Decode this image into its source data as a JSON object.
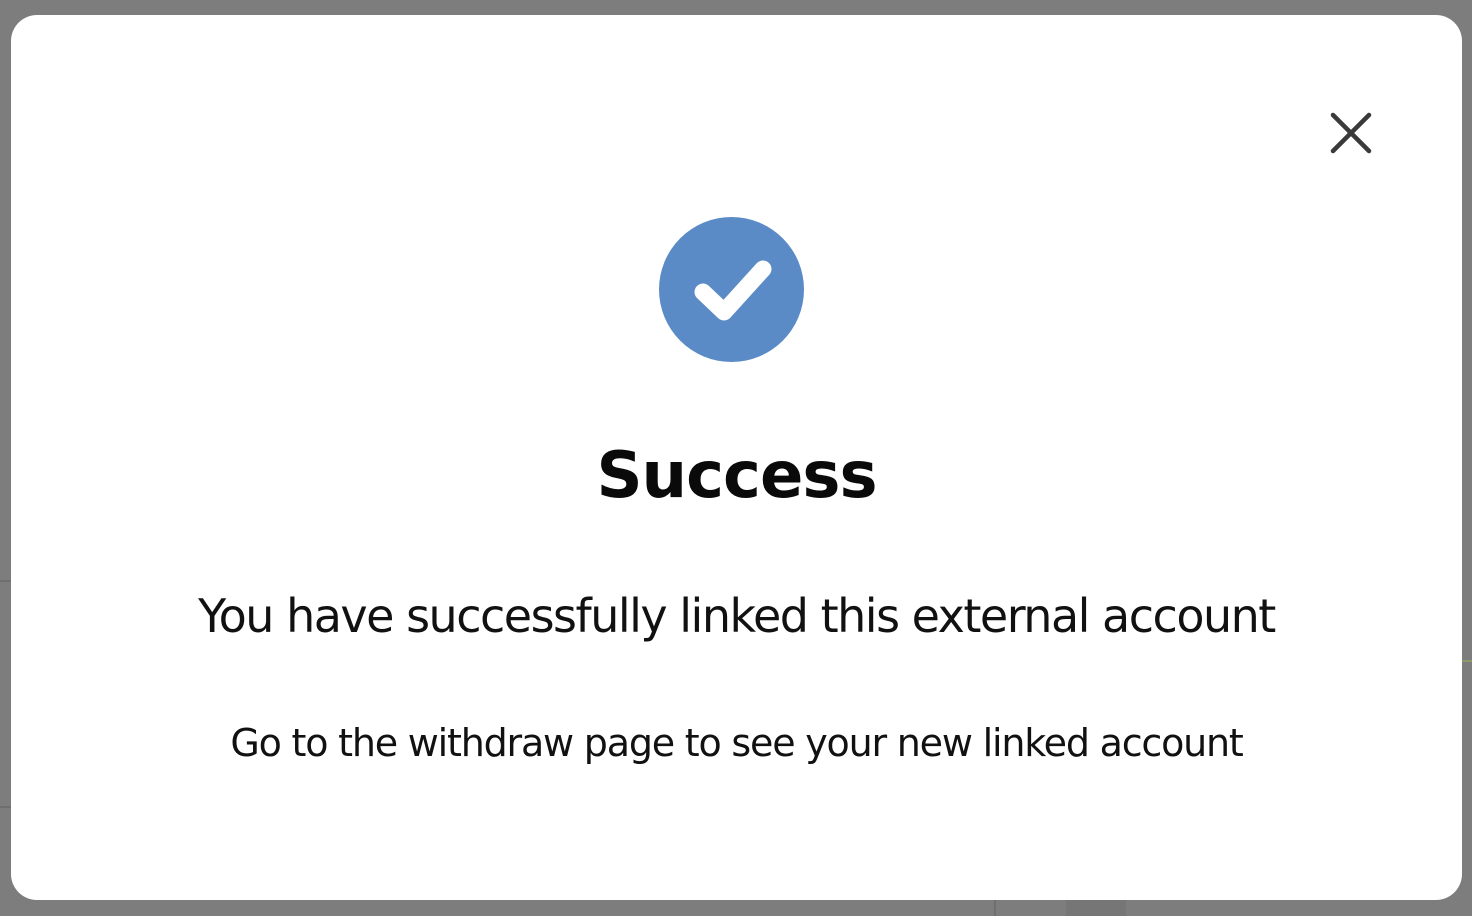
{
  "overlay": {
    "backdrop_color": "#7d7d7d"
  },
  "modal": {
    "close_icon": "close-icon",
    "status_icon": "check-circle-icon",
    "accent_color": "#5b8bc7",
    "title": "Success",
    "message": "You have successfully linked this external account",
    "sub_message": "Go to the withdraw page to see your new linked account"
  }
}
